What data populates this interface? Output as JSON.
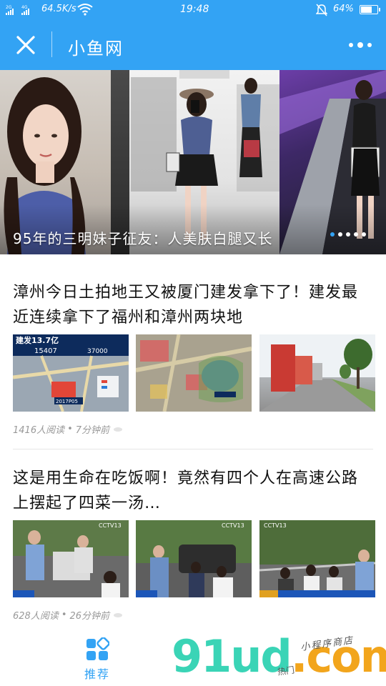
{
  "status_bar": {
    "signal_1": "2G",
    "signal_2": "4G",
    "network_speed": "64.5K/s",
    "time": "19:48",
    "battery_percent": "64%",
    "battery_level": 0.64
  },
  "header": {
    "title": "小鱼网",
    "close_icon": "close-icon",
    "more_icon": "more-dots-icon",
    "background": "#33a3f4"
  },
  "banner": {
    "caption": "95年的三明妹子征友：人美肤白腿又长",
    "dot_count": 5,
    "active_dot": 0
  },
  "articles": [
    {
      "title": "漳州今日土拍地王又被厦门建发拿下了！建发最近连续拿下了福州和漳州两块地",
      "reads": "1416人阅读",
      "time": "7分钟前",
      "thumb_text": {
        "headline": "建发13.7亿",
        "price_a": "15407",
        "price_b": "37000",
        "lot": "2017P05"
      }
    },
    {
      "title": "这是用生命在吃饭啊！竟然有四个人在高速公路上摆起了四菜一汤…",
      "reads": "628人阅读",
      "time": "26分钟前",
      "thumb_text": {
        "channel": "CCTV13"
      }
    }
  ],
  "tabbar": {
    "recommend_label": "推荐",
    "recommend_icon": "grid-icon"
  },
  "watermark": {
    "text_big_g": "91u",
    "text_big_d": "d",
    "text_big_com": ".com",
    "text_small": "小程序商店",
    "text_small_2": "热门"
  }
}
